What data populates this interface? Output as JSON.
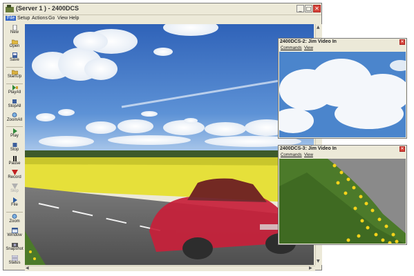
{
  "window": {
    "title": "(Server 1 ) - 2400DCS",
    "controls": {
      "minimize": "_",
      "maximize": "□",
      "close": "✕"
    }
  },
  "menu": [
    {
      "label": "File",
      "active": true
    },
    {
      "label": "Setup"
    },
    {
      "label": "Actions"
    },
    {
      "label": "Go"
    },
    {
      "label": "View"
    },
    {
      "label": "Help"
    }
  ],
  "toolbar": [
    {
      "label": "New",
      "icon": "new-file-icon"
    },
    {
      "label": "Open",
      "icon": "open-folder-icon"
    },
    {
      "label": "Save",
      "icon": "save-disk-icon"
    },
    {
      "label": "StartUp",
      "icon": "startup-folder-icon"
    },
    {
      "label": "PlayAll",
      "icon": "play-all-icon"
    },
    {
      "label": "StopAll",
      "icon": "stop-all-icon"
    },
    {
      "label": "ZoomAll",
      "icon": "zoom-all-icon"
    },
    {
      "label": "Play",
      "icon": "play-icon"
    },
    {
      "label": "Stop",
      "icon": "stop-icon"
    },
    {
      "label": "Pause",
      "icon": "pause-icon"
    },
    {
      "label": "Record",
      "icon": "record-icon"
    },
    {
      "label": "Skip",
      "icon": "skip-icon",
      "disabled": true
    },
    {
      "label": "File",
      "icon": "file-play-icon"
    },
    {
      "label": "Zoom",
      "icon": "zoom-icon"
    },
    {
      "label": "Window",
      "icon": "window-icon"
    },
    {
      "label": "Snapshot",
      "icon": "snapshot-camera-icon"
    },
    {
      "label": "Status",
      "icon": "status-icon"
    }
  ],
  "sub_windows": [
    {
      "title": "2400DCS-2: Jim Video In",
      "menu": [
        "Commands",
        "View"
      ],
      "close": "✕"
    },
    {
      "title": "2400DCS-3: Jim Video In",
      "menu": [
        "Commands",
        "View"
      ],
      "close": "✕"
    }
  ],
  "colors": {
    "chrome": "#ece9d8",
    "menu_highlight": "#3164c8",
    "close_button": "#d6453a",
    "sky": "#3f78c8",
    "field_yellow": "#e8e23a",
    "car_red": "#c8203a",
    "road": "#6b6b6b",
    "grass_green": "#4c7a2a",
    "dandelion": "#f5d31a"
  },
  "scroll": {
    "up": "▲",
    "down": "▼",
    "left": "◀",
    "right": "▶"
  }
}
